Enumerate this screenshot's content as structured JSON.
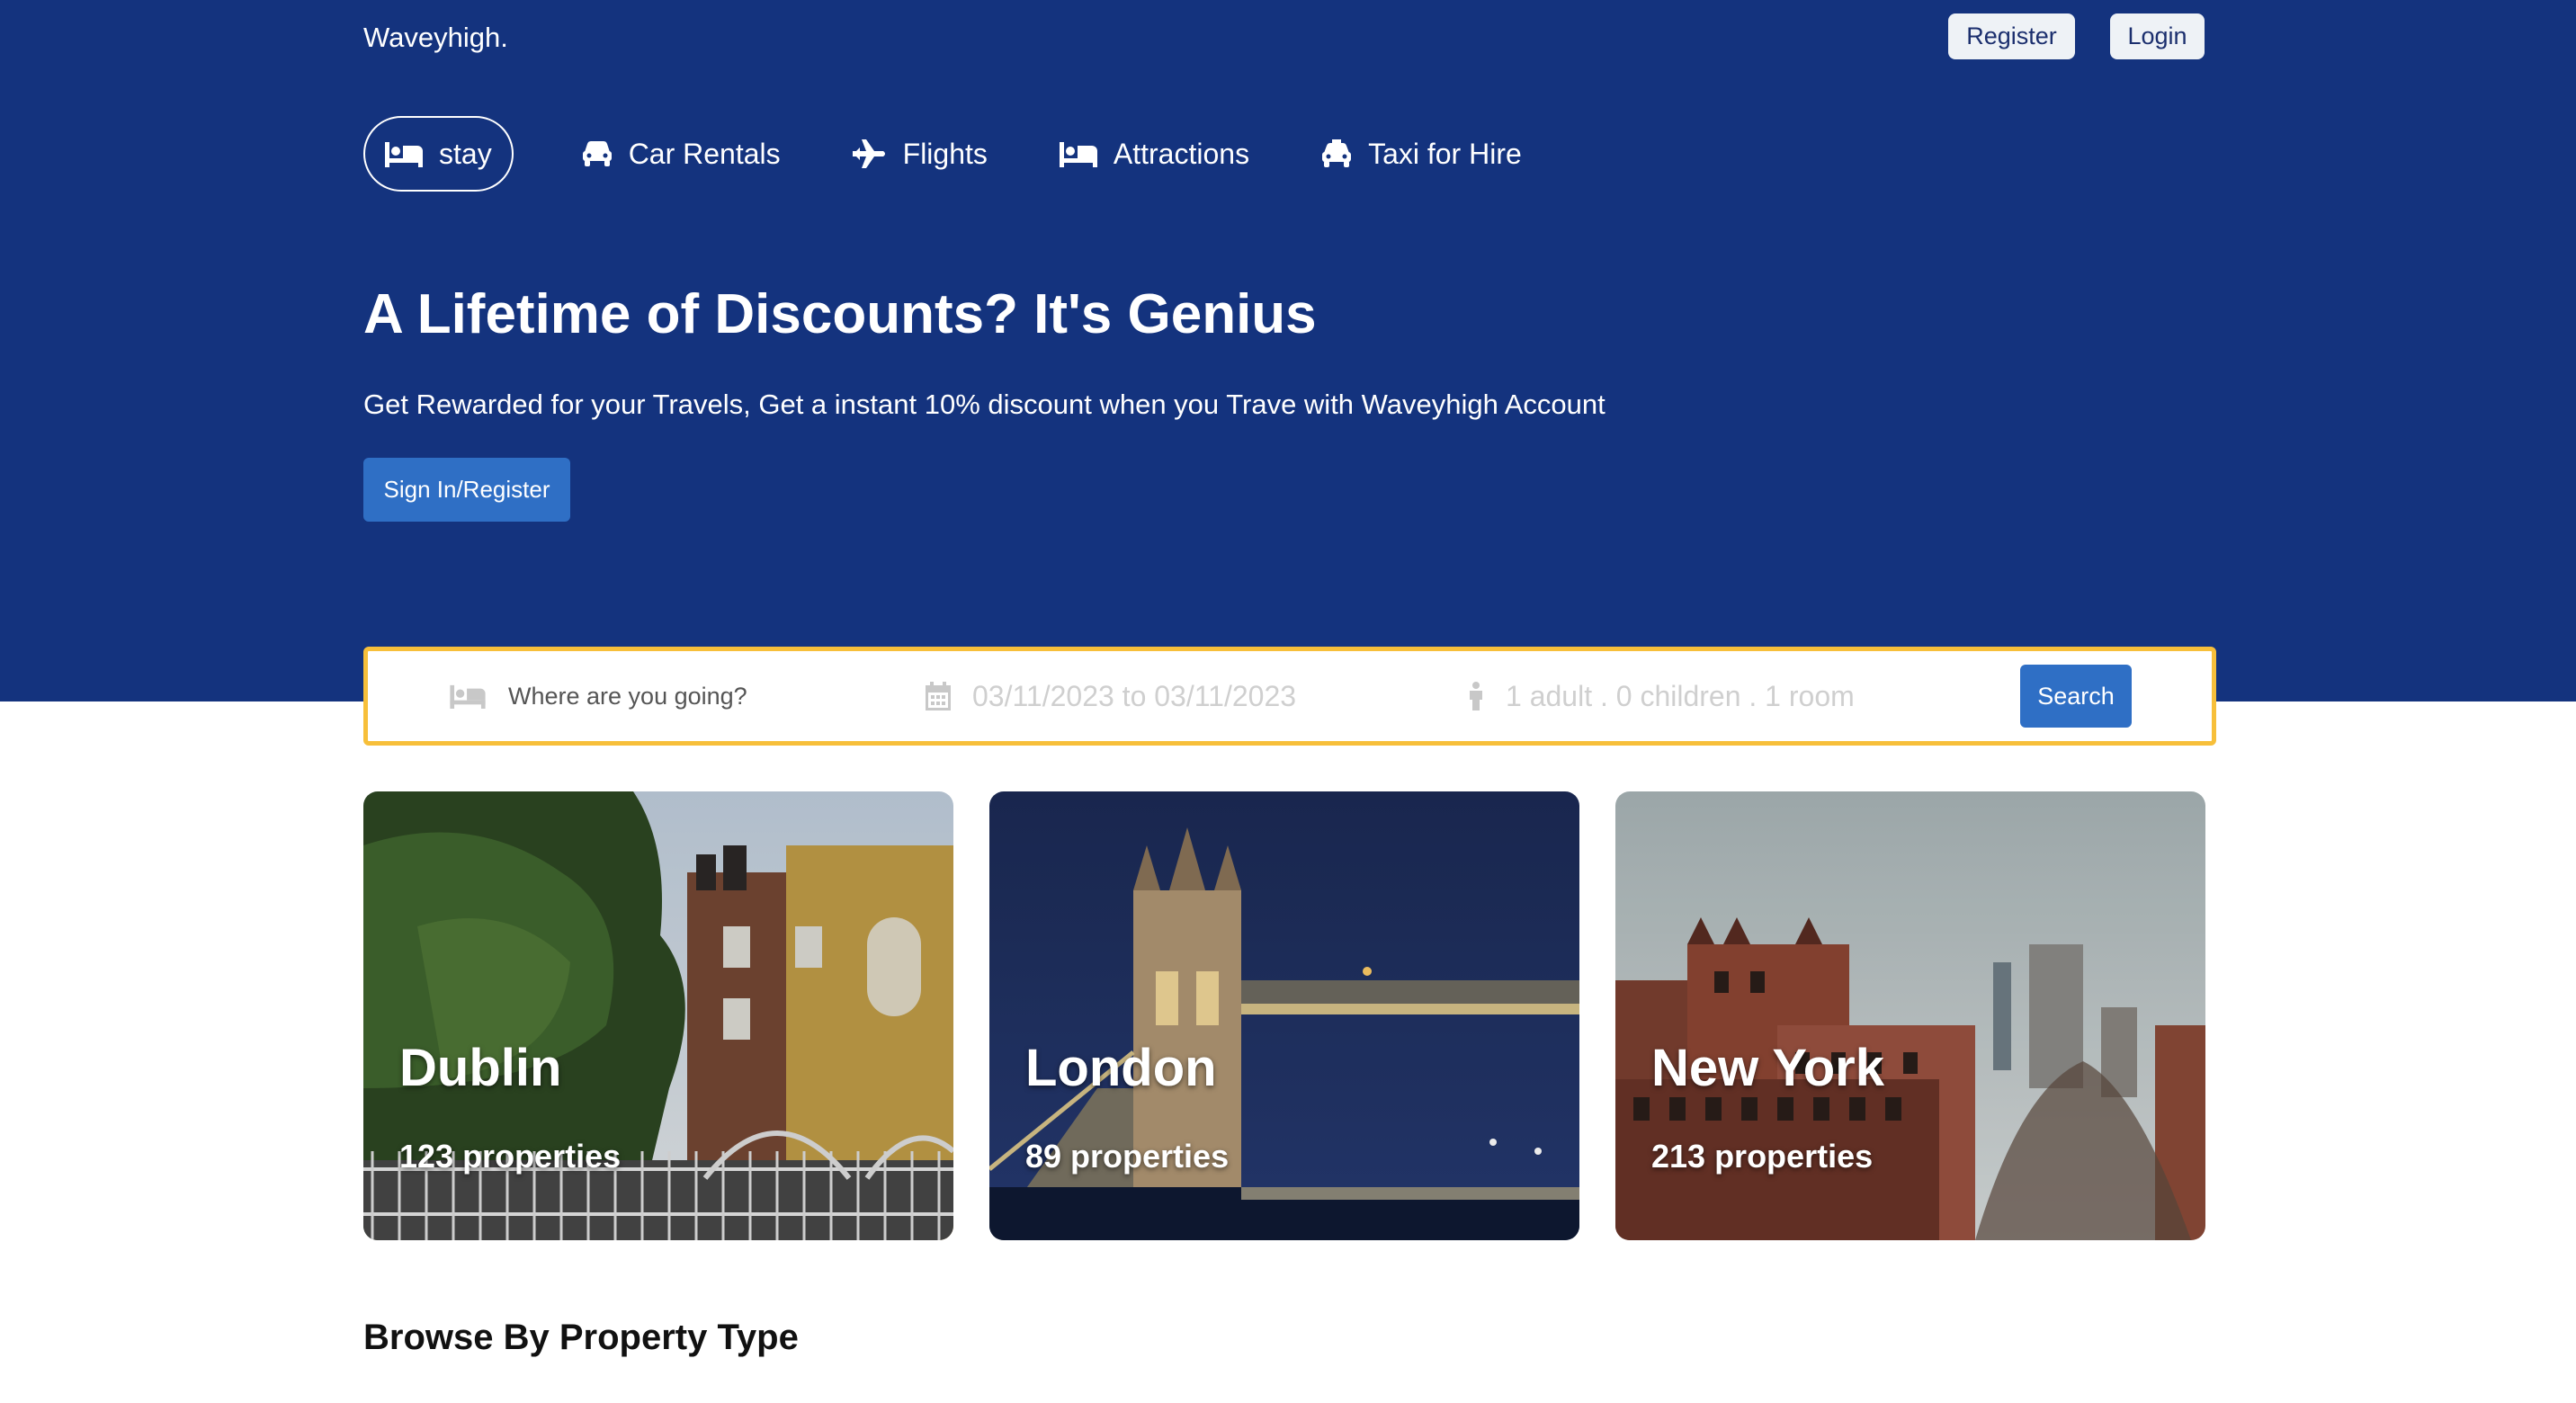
{
  "header": {
    "logo": "Waveyhigh.",
    "register_label": "Register",
    "login_label": "Login"
  },
  "nav": {
    "items": [
      {
        "label": "stay",
        "icon": "bed-icon",
        "active": true
      },
      {
        "label": "Car Rentals",
        "icon": "car-icon",
        "active": false
      },
      {
        "label": "Flights",
        "icon": "plane-icon",
        "active": false
      },
      {
        "label": "Attractions",
        "icon": "bed-icon",
        "active": false
      },
      {
        "label": "Taxi for Hire",
        "icon": "taxi-icon",
        "active": false
      }
    ]
  },
  "hero": {
    "title": "A Lifetime of Discounts? It's Genius",
    "subtitle": "Get Rewarded for your Travels, Get a instant 10% discount when you Trave with Waveyhigh Account",
    "cta_label": "Sign In/Register"
  },
  "search": {
    "destination_placeholder": "Where are you going?",
    "dates": "03/11/2023 to 03/11/2023",
    "guests": "1 adult . 0 children . 1 room",
    "button_label": "Search"
  },
  "cities": [
    {
      "name": "Dublin",
      "properties": "123 properties"
    },
    {
      "name": "London",
      "properties": "89 properties"
    },
    {
      "name": "New York",
      "properties": "213 properties"
    }
  ],
  "browse": {
    "title": "Browse By Property Type"
  },
  "colors": {
    "hero_bg": "#14337e",
    "primary_button": "#2f6fc5",
    "search_border": "#f7bf3a"
  }
}
